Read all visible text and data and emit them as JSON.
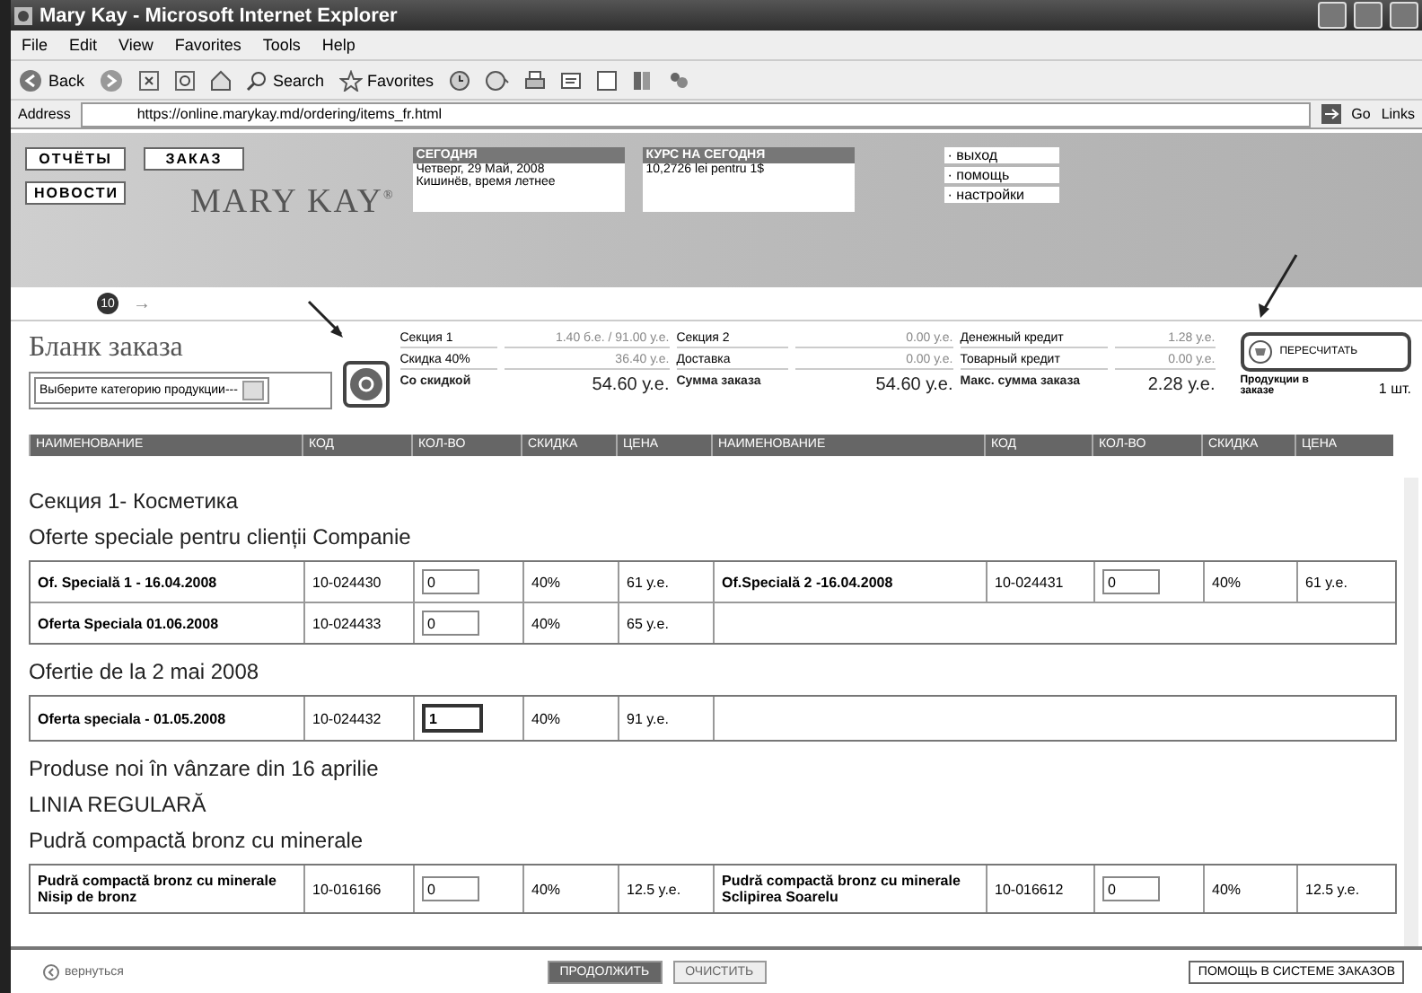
{
  "window": {
    "title": "Mary Kay - Microsoft Internet Explorer"
  },
  "menu": [
    "File",
    "Edit",
    "View",
    "Favorites",
    "Tools",
    "Help"
  ],
  "toolbar": {
    "back": "Back",
    "search": "Search",
    "favorites": "Favorites"
  },
  "address": {
    "label": "Address",
    "url": "https://online.marykay.md/ordering/items_fr.html",
    "go": "Go",
    "links": "Links"
  },
  "banner": {
    "nav": [
      "ОТЧЁТЫ",
      "ЗАКАЗ",
      "НОВОСТИ"
    ],
    "logo": "MARY KAY$^{®}$",
    "today": {
      "title": "СЕГОДНЯ",
      "lines": [
        "Четверг, 29 Май, 2008",
        "Кишинёв, время летнее"
      ]
    },
    "rate": {
      "title": "КУРС НА СЕГОДНЯ",
      "lines": [
        "10,2726 lei pentru 1$"
      ]
    },
    "links": [
      "· выход",
      "· помощь",
      "· настройки"
    ]
  },
  "steps": {
    "number": "10",
    "arrow": "→"
  },
  "form": {
    "title": "Бланк заказа",
    "category_select": "Выберите категорию продукции---",
    "summary": [
      {
        "kind": "plain",
        "cells": [
          {
            "label": "Секция 1",
            "value": "1.40 б.е. / 91.00 у.е."
          },
          {
            "label": "Секция 2",
            "value": "0.00 у.е."
          },
          {
            "label": "Денежный кредит",
            "value": "1.28 у.е."
          }
        ]
      },
      {
        "kind": "plain",
        "cells": [
          {
            "label": "Скидка 40%",
            "value": "36.40 у.е."
          },
          {
            "label": "Доставка",
            "value": "0.00 у.е."
          },
          {
            "label": "Товарный кредит",
            "value": "0.00 у.е."
          }
        ]
      },
      {
        "kind": "total",
        "cells": [
          {
            "label": "Со скидкой",
            "value": "54.60 у.е."
          },
          {
            "label": "Сумма заказа",
            "value": "54.60 у.е."
          },
          {
            "label": "Макс. сумма заказа",
            "value": "2.28 у.е."
          }
        ]
      }
    ],
    "recalc": "ПЕРЕСЧИТАТЬ",
    "items_label": "Продукции в заказе",
    "items_count": "1 шт."
  },
  "table": {
    "columns": [
      "НАИМЕНОВАНИЕ",
      "КОД",
      "КОЛ-ВО",
      "СКИДКА",
      "ЦЕНА",
      "НАИМЕНОВАНИЕ",
      "КОД",
      "КОЛ-ВО",
      "СКИДКА",
      "ЦЕНА"
    ],
    "sections": [
      {
        "kind": "heading",
        "text": "Секция 1- Косметика"
      },
      {
        "kind": "heading",
        "text": "Oferte speciale pentru clienții Companie"
      },
      {
        "kind": "products",
        "rows": [
          [
            {
              "name": "Of. Specială 1 - 16.04.2008",
              "code": "10-024430",
              "quantity": "0",
              "focused": false,
              "discount": "40%",
              "price": "61 y.e."
            },
            {
              "name": "Of.Specială 2 -16.04.2008",
              "code": "10-024431",
              "quantity": "0",
              "focused": false,
              "discount": "40%",
              "price": "61 y.e."
            }
          ],
          [
            {
              "name": "Oferta Speciala 01.06.2008",
              "code": "10-024433",
              "quantity": "0",
              "focused": false,
              "discount": "40%",
              "price": "65 y.e."
            }
          ]
        ]
      },
      {
        "kind": "heading",
        "text": "Ofertie de la 2 mai 2008"
      },
      {
        "kind": "products",
        "rows": [
          [
            {
              "name": "Oferta speciala - 01.05.2008",
              "code": "10-024432",
              "quantity": "1",
              "focused": true,
              "discount": "40%",
              "price": "91 y.e."
            }
          ]
        ]
      },
      {
        "kind": "heading",
        "text": "Produse noi în vânzare din 16 aprilie"
      },
      {
        "kind": "heading",
        "text": "LINIA REGULARĂ"
      },
      {
        "kind": "heading",
        "text": "Pudră compactă bronz cu minerale"
      },
      {
        "kind": "products",
        "rows": [
          [
            {
              "name": "Pudră compactă bronz cu minerale Nisip de bronz",
              "code": "10-016166",
              "quantity": "0",
              "focused": false,
              "discount": "40%",
              "price": "12.5 y.e."
            },
            {
              "name": "Pudră compactă bronz cu minerale Sclipirea Soarelu",
              "code": "10-016612",
              "quantity": "0",
              "focused": false,
              "discount": "40%",
              "price": "12.5 y.e."
            }
          ]
        ]
      }
    ]
  },
  "footer": {
    "back": "вернуться",
    "buttons": [
      {
        "label": "ПРОДОЛЖИТЬ",
        "kind": "primary"
      },
      {
        "label": "ОЧИСТИТЬ",
        "kind": "secondary"
      }
    ],
    "help": "ПОМОЩЬ В СИСТЕМЕ ЗАКАЗОВ"
  }
}
